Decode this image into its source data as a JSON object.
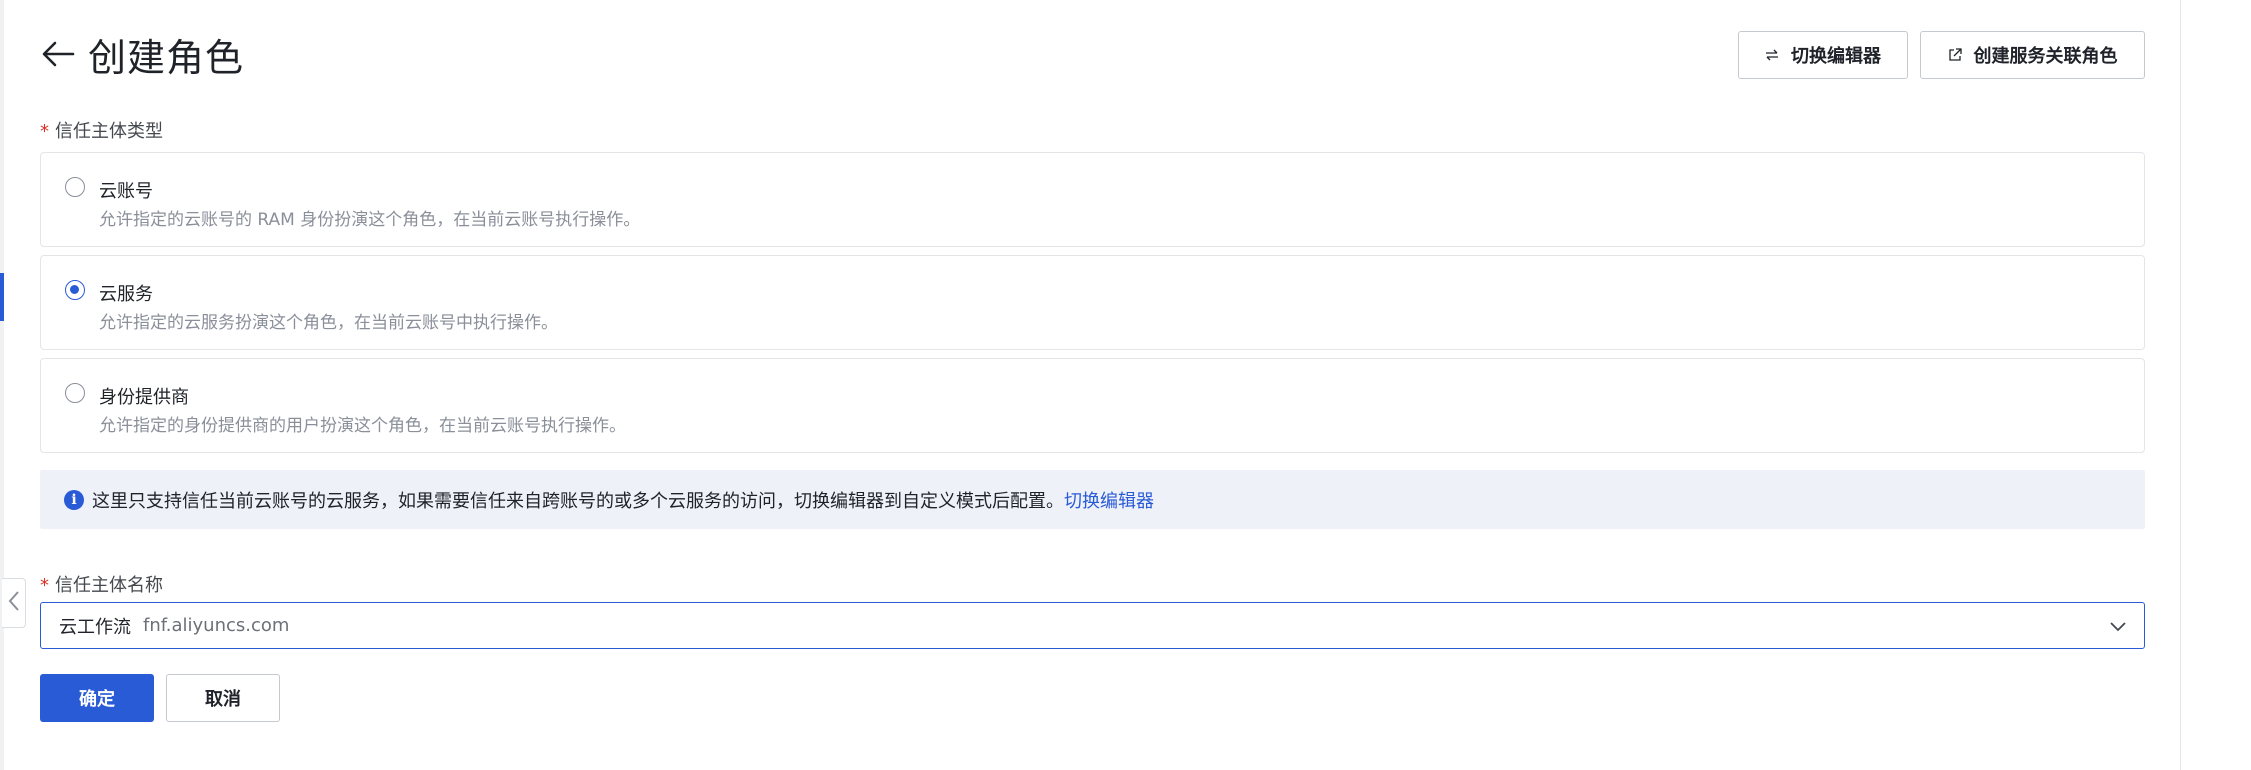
{
  "page": {
    "title": "创建角色",
    "back_icon": "arrow-left-icon"
  },
  "toolbar": {
    "switch_editor_label": "切换编辑器",
    "switch_editor_icon": "swap-arrows-icon",
    "create_service_role_label": "创建服务关联角色",
    "create_service_role_icon": "external-link-icon"
  },
  "trust_type": {
    "required_mark": "*",
    "label": "信任主体类型",
    "options": [
      {
        "title": "云账号",
        "description": "允许指定的云账号的 RAM 身份扮演这个角色，在当前云账号执行操作。",
        "selected": false
      },
      {
        "title": "云服务",
        "description": "允许指定的云服务扮演这个角色，在当前云账号中执行操作。",
        "selected": true
      },
      {
        "title": "身份提供商",
        "description": "允许指定的身份提供商的用户扮演这个角色，在当前云账号执行操作。",
        "selected": false
      }
    ]
  },
  "notice": {
    "icon": "info-icon",
    "icon_glyph": "i",
    "text": "这里只支持信任当前云账号的云服务，如果需要信任来自跨账号的或多个云服务的访问，切换编辑器到自定义模式后配置。",
    "link_label": "切换编辑器"
  },
  "trust_name": {
    "required_mark": "*",
    "label": "信任主体名称",
    "selected_name": "云工作流",
    "selected_domain": "fnf.aliyuncs.com"
  },
  "actions": {
    "confirm_label": "确定",
    "cancel_label": "取消"
  },
  "colors": {
    "primary": "#2a5bd7",
    "required": "#d93026",
    "notice_bg": "#eef1f7",
    "border": "#e3e5e8"
  }
}
